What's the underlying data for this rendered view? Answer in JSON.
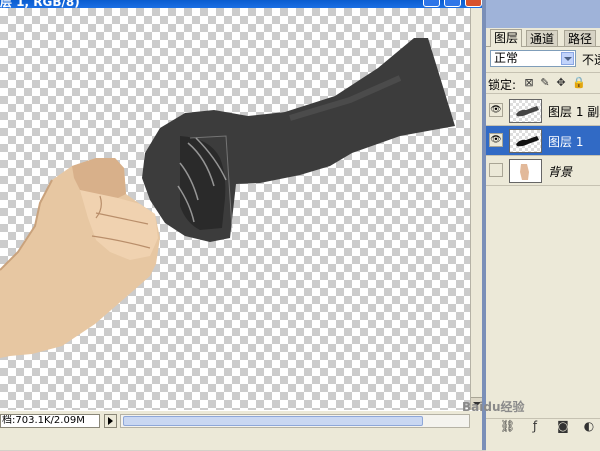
{
  "document": {
    "title": "层 1, RGB/8)",
    "status_text": "档:703.1K/2.09M"
  },
  "layers_panel": {
    "tabs": [
      "图层",
      "通道",
      "路径"
    ],
    "blend_mode": "正常",
    "opacity_label": "不透",
    "lock_label": "锁定:",
    "lock_icons": [
      "lock-transparency-icon",
      "lock-paint-icon",
      "lock-move-icon",
      "lock-all-icon"
    ],
    "layers": [
      {
        "name": "图层 1 副本",
        "visible": true,
        "selected": false,
        "thumb": "grey-fist"
      },
      {
        "name": "图层 1",
        "visible": true,
        "selected": true,
        "thumb": "grey-fist"
      },
      {
        "name": "背景",
        "visible": false,
        "selected": false,
        "thumb": "hand"
      }
    ],
    "bottom_icons": [
      "link-icon",
      "fx-icon",
      "mask-icon",
      "adjustment-icon"
    ]
  },
  "watermark": "Baidu经验",
  "colors": {
    "selected_layer": "#316ac5",
    "titlebar": "#0a5ccf",
    "panel_bg": "#ece9d8"
  }
}
